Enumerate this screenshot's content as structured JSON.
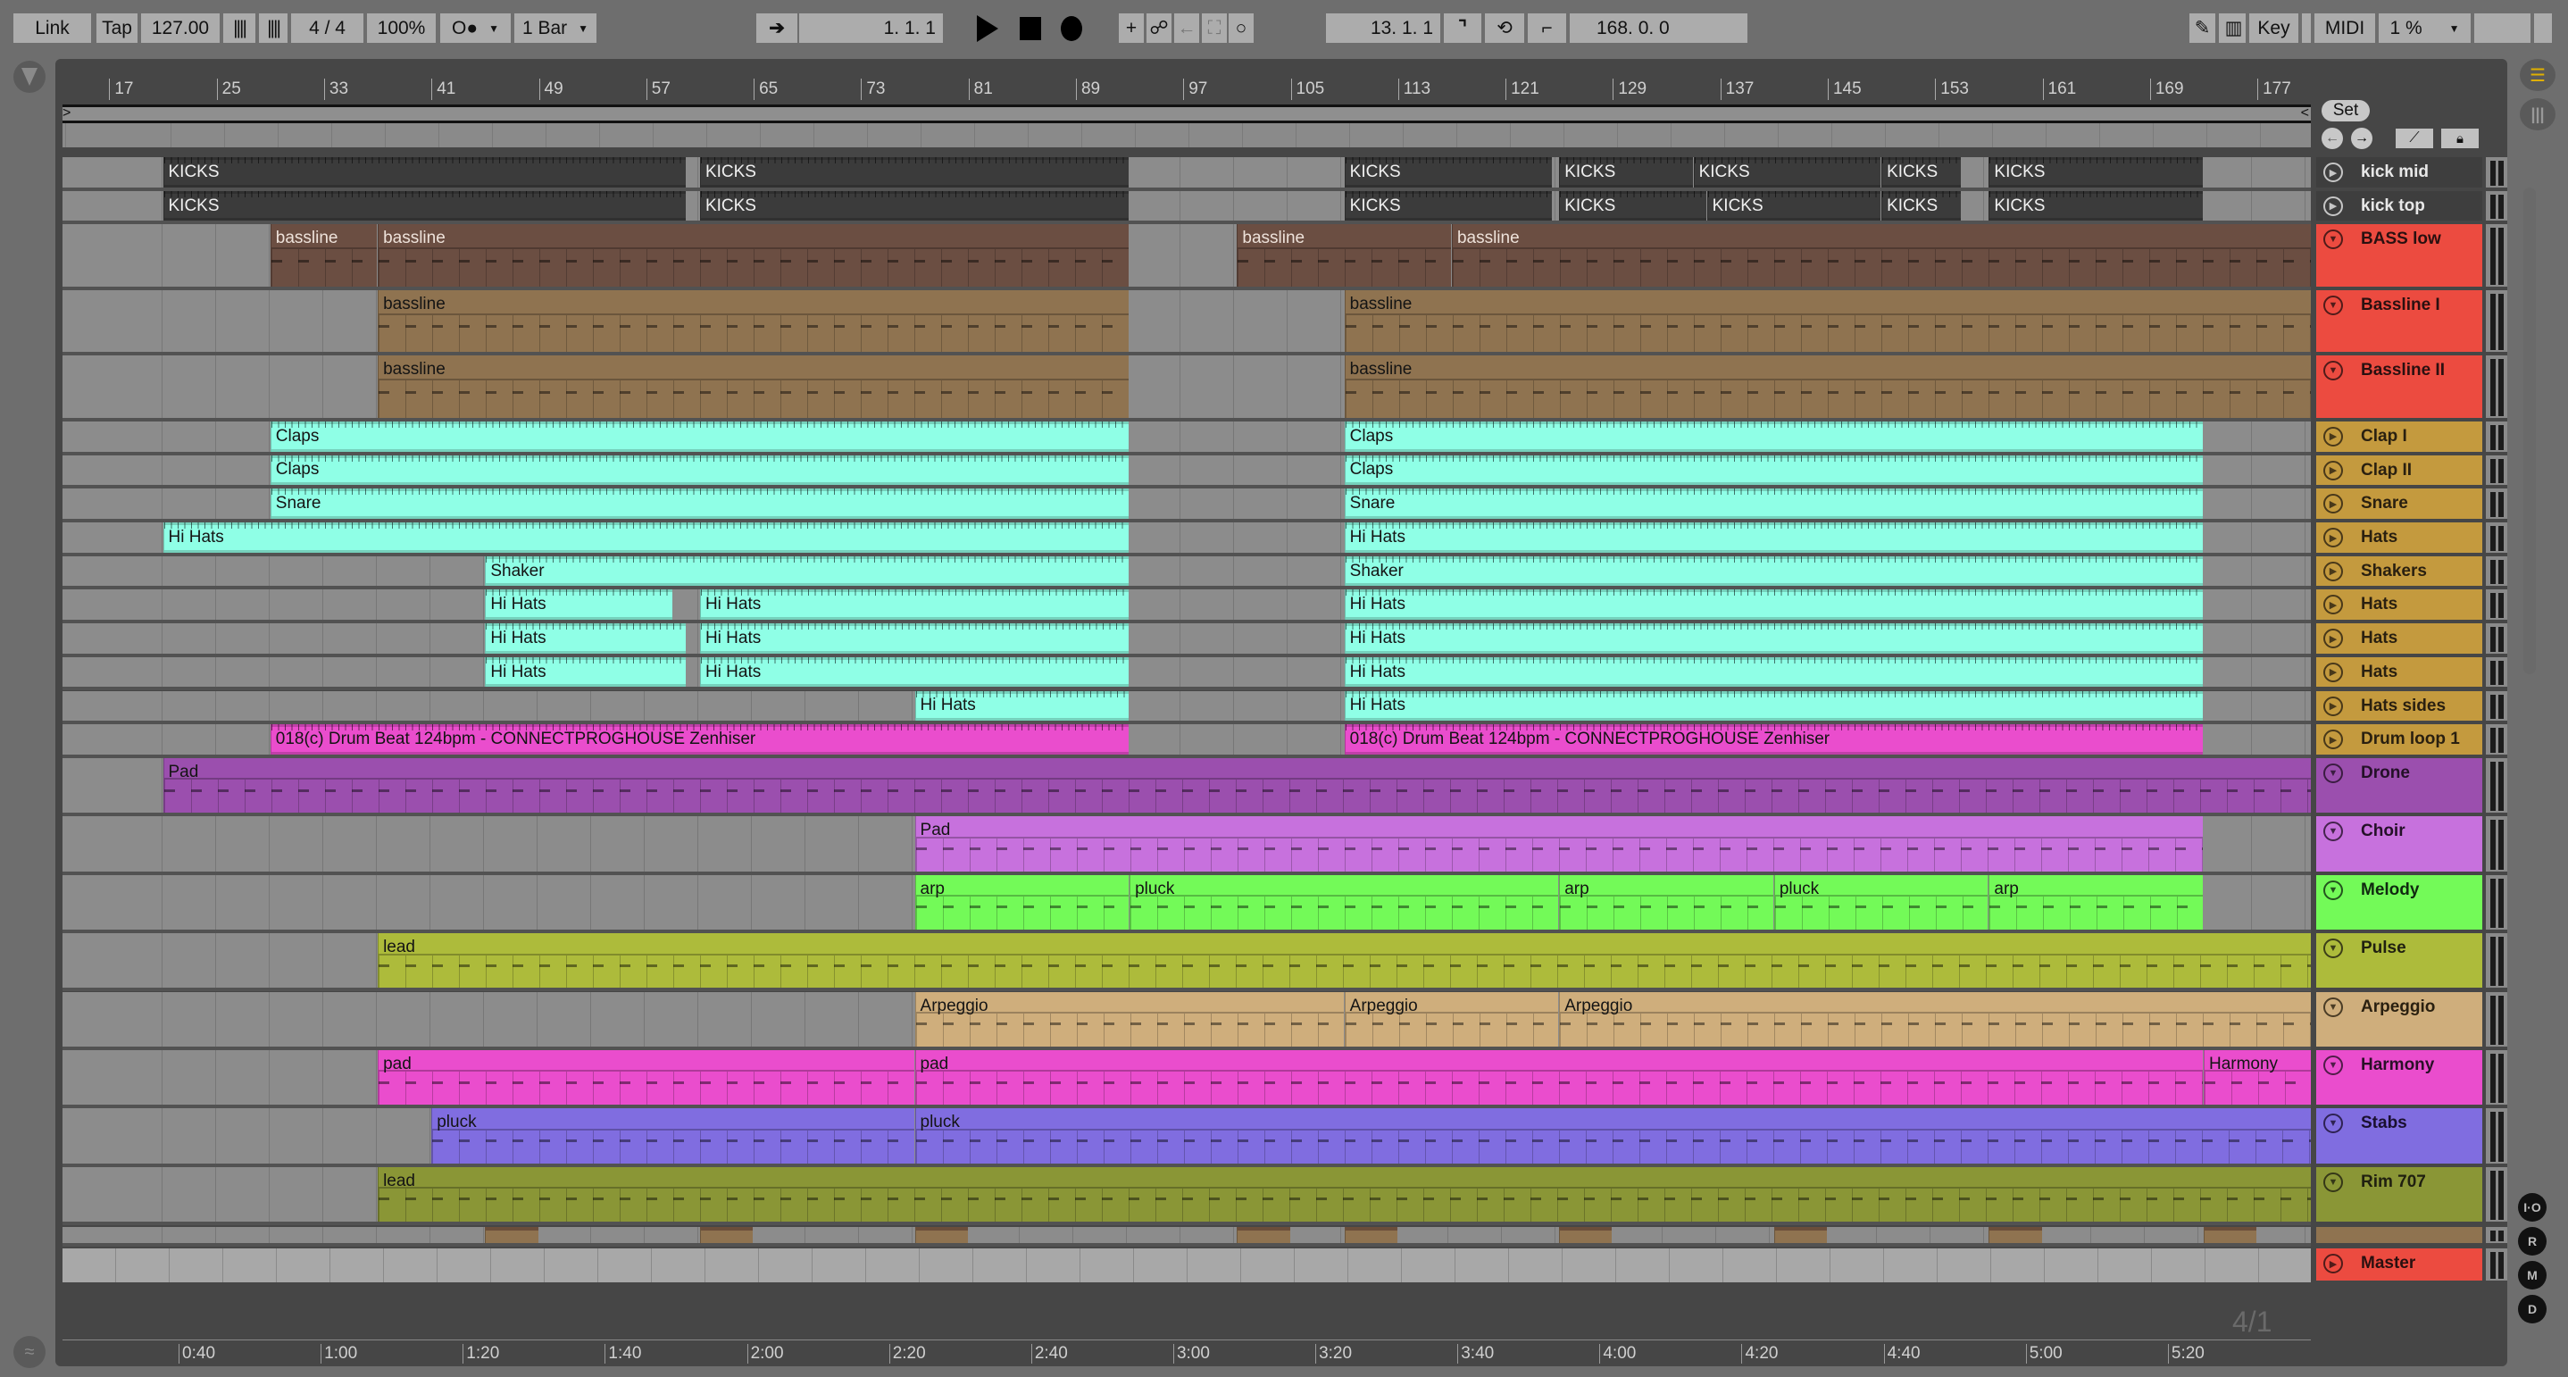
{
  "toolbar": {
    "link": "Link",
    "tap": "Tap",
    "tempo": "127.00",
    "signature": "4 / 4",
    "zoom": "100%",
    "metronome": "O●",
    "quantize": "1 Bar",
    "position": "1.   1.   1",
    "loop_start": "13.   1.   1",
    "loop_length": "168.   0.   0",
    "key": "Key",
    "midi": "MIDI",
    "cpu": "1 %"
  },
  "tempo_bpm": 127,
  "ruler": {
    "bar_labels": [
      "17",
      "25",
      "33",
      "41",
      "49",
      "57",
      "65",
      "73",
      "81",
      "89",
      "97",
      "105",
      "113",
      "121",
      "129",
      "137",
      "145",
      "153",
      "161",
      "169",
      "177"
    ]
  },
  "set_button": "Set",
  "time_labels": [
    "0:40",
    "1:00",
    "1:20",
    "1:40",
    "2:00",
    "2:20",
    "2:40",
    "3:00",
    "3:20",
    "3:40",
    "4:00",
    "4:20",
    "4:40",
    "5:00",
    "5:20"
  ],
  "time_signature_marker": "4/1",
  "side_buttons": [
    "I·O",
    "R",
    "M",
    "D"
  ],
  "tracks": [
    {
      "name": "kick mid",
      "color": "#3e3e3e",
      "text": "#e8e8e8",
      "clip_color": "#3b3b3b",
      "clip_text": "#f0f0f0",
      "clips": [
        {
          "label": "KICKS",
          "start": 21,
          "end": 60
        },
        {
          "label": "KICKS",
          "start": 61,
          "end": 93
        },
        {
          "label": "KICKS",
          "start": 109,
          "end": 124.5
        },
        {
          "label": "KICKS",
          "start": 125,
          "end": 135
        },
        {
          "label": "KICKS",
          "start": 135,
          "end": 149
        },
        {
          "label": "KICKS",
          "start": 149,
          "end": 155
        },
        {
          "label": "KICKS",
          "start": 157,
          "end": 173
        }
      ]
    },
    {
      "name": "kick top",
      "color": "#3e3e3e",
      "text": "#e8e8e8",
      "clip_color": "#3b3b3b",
      "clip_text": "#f0f0f0",
      "clips": [
        {
          "label": "KICKS",
          "start": 21,
          "end": 60
        },
        {
          "label": "KICKS",
          "start": 61,
          "end": 93
        },
        {
          "label": "KICKS",
          "start": 109,
          "end": 124.5
        },
        {
          "label": "KICKS",
          "start": 125,
          "end": 136
        },
        {
          "label": "KICKS",
          "start": 136,
          "end": 149
        },
        {
          "label": "KICKS",
          "start": 149,
          "end": 155
        },
        {
          "label": "KICKS",
          "start": 157,
          "end": 173
        }
      ]
    },
    {
      "name": "BASS low",
      "color": "#ec4b40",
      "text": "#2a1010",
      "clip_color": "#6b4e42",
      "clip_text": "#eee2da",
      "clips": [
        {
          "label": "bassline",
          "start": 29,
          "end": 37
        },
        {
          "label": "bassline",
          "start": 37,
          "end": 93
        },
        {
          "label": "bassline",
          "start": 101,
          "end": 117
        },
        {
          "label": "bassline",
          "start": 117,
          "end": 185
        }
      ]
    },
    {
      "name": "Bassline I",
      "color": "#ec4b40",
      "text": "#2a1010",
      "clip_color": "#8f7350",
      "clip_text": "#141414",
      "clips": [
        {
          "label": "bassline",
          "start": 37,
          "end": 93
        },
        {
          "label": "bassline",
          "start": 109,
          "end": 185
        }
      ]
    },
    {
      "name": "Bassline II",
      "color": "#ec4b40",
      "text": "#2a1010",
      "clip_color": "#8f7350",
      "clip_text": "#141414",
      "clips": [
        {
          "label": "bassline",
          "start": 37,
          "end": 93
        },
        {
          "label": "bassline",
          "start": 109,
          "end": 185
        }
      ]
    },
    {
      "name": "Clap I",
      "color": "#c49a3e",
      "text": "#2a2010",
      "clip_color": "#8fffe6",
      "clip_text": "#141414",
      "clips": [
        {
          "label": "Claps",
          "start": 29,
          "end": 93
        },
        {
          "label": "Claps",
          "start": 109,
          "end": 173
        }
      ]
    },
    {
      "name": "Clap II",
      "color": "#c49a3e",
      "text": "#2a2010",
      "clip_color": "#8fffe6",
      "clip_text": "#141414",
      "clips": [
        {
          "label": "Claps",
          "start": 29,
          "end": 93
        },
        {
          "label": "Claps",
          "start": 109,
          "end": 173
        }
      ]
    },
    {
      "name": "Snare",
      "color": "#c49a3e",
      "text": "#2a2010",
      "clip_color": "#8fffe6",
      "clip_text": "#141414",
      "clips": [
        {
          "label": "Snare",
          "start": 29,
          "end": 93
        },
        {
          "label": "Snare",
          "start": 109,
          "end": 173
        }
      ]
    },
    {
      "name": "Hats",
      "color": "#c49a3e",
      "text": "#2a2010",
      "clip_color": "#8fffe6",
      "clip_text": "#141414",
      "clips": [
        {
          "label": "Hi Hats",
          "start": 21,
          "end": 93
        },
        {
          "label": "Hi Hats",
          "start": 109,
          "end": 173
        }
      ]
    },
    {
      "name": "Shakers",
      "color": "#c49a3e",
      "text": "#2a2010",
      "clip_color": "#8fffe6",
      "clip_text": "#141414",
      "clips": [
        {
          "label": "Shaker",
          "start": 45,
          "end": 93
        },
        {
          "label": "Shaker",
          "start": 109,
          "end": 173
        }
      ]
    },
    {
      "name": "Hats",
      "color": "#c49a3e",
      "text": "#2a2010",
      "clip_color": "#8fffe6",
      "clip_text": "#141414",
      "clips": [
        {
          "label": "Hi Hats",
          "start": 45,
          "end": 59
        },
        {
          "label": "Hi Hats",
          "start": 61,
          "end": 93
        },
        {
          "label": "Hi Hats",
          "start": 109,
          "end": 173
        }
      ]
    },
    {
      "name": "Hats",
      "color": "#c49a3e",
      "text": "#2a2010",
      "clip_color": "#8fffe6",
      "clip_text": "#141414",
      "clips": [
        {
          "label": "Hi Hats",
          "start": 45,
          "end": 60
        },
        {
          "label": "Hi Hats",
          "start": 61,
          "end": 93
        },
        {
          "label": "Hi Hats",
          "start": 109,
          "end": 173
        }
      ]
    },
    {
      "name": "Hats",
      "color": "#c49a3e",
      "text": "#2a2010",
      "clip_color": "#8fffe6",
      "clip_text": "#141414",
      "clips": [
        {
          "label": "Hi Hats",
          "start": 45,
          "end": 60
        },
        {
          "label": "Hi Hats",
          "start": 61,
          "end": 93
        },
        {
          "label": "Hi Hats",
          "start": 109,
          "end": 173
        }
      ]
    },
    {
      "name": "Hats sides",
      "color": "#c49a3e",
      "text": "#2a2010",
      "clip_color": "#8fffe6",
      "clip_text": "#141414",
      "clips": [
        {
          "label": "Hi Hats",
          "start": 77,
          "end": 93
        },
        {
          "label": "Hi Hats",
          "start": 109,
          "end": 173
        }
      ]
    },
    {
      "name": "Drum loop 1",
      "color": "#c49a3e",
      "text": "#2a2010",
      "clip_color": "#ea4dcd",
      "clip_text": "#141414",
      "clips": [
        {
          "label": "018(c) Drum Beat 124bpm - CONNECTPROGHOUSE Zenhiser",
          "start": 29,
          "end": 93
        },
        {
          "label": "018(c) Drum Beat 124bpm - CONNECTPROGHOUSE Zenhiser",
          "start": 109,
          "end": 173
        }
      ]
    },
    {
      "name": "Drone",
      "color": "#9b4fae",
      "text": "#241028",
      "clip_color": "#9b4fae",
      "clip_text": "#141414",
      "clips": [
        {
          "label": "Pad",
          "start": 21,
          "end": 185
        }
      ]
    },
    {
      "name": "Choir",
      "color": "#c771dd",
      "text": "#241028",
      "clip_color": "#c771dd",
      "clip_text": "#141414",
      "clips": [
        {
          "label": "Pad",
          "start": 77,
          "end": 173
        }
      ]
    },
    {
      "name": "Melody",
      "color": "#73fa58",
      "text": "#102a10",
      "clip_color": "#73fa58",
      "clip_text": "#141414",
      "clips": [
        {
          "label": "arp",
          "start": 77,
          "end": 93
        },
        {
          "label": "pluck",
          "start": 93,
          "end": 125
        },
        {
          "label": "arp",
          "start": 125,
          "end": 141
        },
        {
          "label": "pluck",
          "start": 141,
          "end": 157
        },
        {
          "label": "arp",
          "start": 157,
          "end": 173
        }
      ]
    },
    {
      "name": "Pulse",
      "color": "#adbb3b",
      "text": "#202010",
      "clip_color": "#adbb3b",
      "clip_text": "#141414",
      "clips": [
        {
          "label": "lead",
          "start": 37,
          "end": 185
        }
      ]
    },
    {
      "name": "Arpeggio",
      "color": "#cfae7c",
      "text": "#2a2010",
      "clip_color": "#cfae7c",
      "clip_text": "#141414",
      "clips": [
        {
          "label": "Arpeggio",
          "start": 77,
          "end": 109
        },
        {
          "label": "Arpeggio",
          "start": 109,
          "end": 125
        },
        {
          "label": "Arpeggio",
          "start": 125,
          "end": 185
        }
      ]
    },
    {
      "name": "Harmony",
      "color": "#ea4dcd",
      "text": "#2a1028",
      "clip_color": "#ea4dcd",
      "clip_text": "#141414",
      "clips": [
        {
          "label": "pad",
          "start": 37,
          "end": 77
        },
        {
          "label": "pad",
          "start": 77,
          "end": 173
        },
        {
          "label": "Harmony",
          "start": 173,
          "end": 185
        }
      ]
    },
    {
      "name": "Stabs",
      "color": "#806de0",
      "text": "#1a1030",
      "clip_color": "#806de0",
      "clip_text": "#141414",
      "clips": [
        {
          "label": "pluck",
          "start": 41,
          "end": 77
        },
        {
          "label": "pluck",
          "start": 77,
          "end": 185
        }
      ]
    },
    {
      "name": "Rim 707",
      "color": "#8a9636",
      "text": "#202010",
      "clip_color": "#8a9636",
      "clip_text": "#141414",
      "clips": [
        {
          "label": "lead",
          "start": 37,
          "end": 185
        }
      ]
    }
  ],
  "collapsed_track": {
    "color": "#8f7350",
    "clip_starts": [
      45,
      61,
      77,
      101,
      109,
      125,
      141,
      157,
      173
    ],
    "clip_length": 4
  },
  "master": {
    "name": "Master",
    "color": "#ec4b40",
    "text": "#2a1010"
  }
}
